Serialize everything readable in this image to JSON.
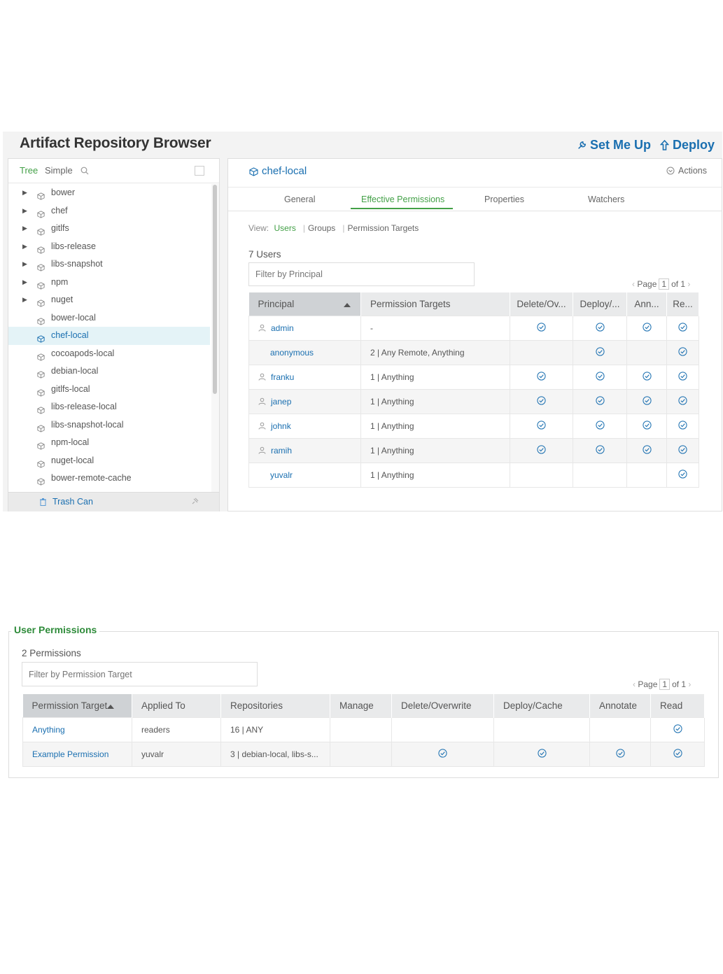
{
  "app": {
    "title": "Artifact Repository Browser",
    "set_me_up": "Set Me Up",
    "deploy": "Deploy"
  },
  "tree": {
    "tab_tree": "Tree",
    "tab_simple": "Simple",
    "items": [
      {
        "label": "bower",
        "expandable": true
      },
      {
        "label": "chef",
        "expandable": true
      },
      {
        "label": "gitlfs",
        "expandable": true
      },
      {
        "label": "libs-release",
        "expandable": true
      },
      {
        "label": "libs-snapshot",
        "expandable": true
      },
      {
        "label": "npm",
        "expandable": true
      },
      {
        "label": "nuget",
        "expandable": true
      },
      {
        "label": "bower-local",
        "expandable": false
      },
      {
        "label": "chef-local",
        "expandable": false,
        "selected": true
      },
      {
        "label": "cocoapods-local",
        "expandable": false
      },
      {
        "label": "debian-local",
        "expandable": false
      },
      {
        "label": "gitlfs-local",
        "expandable": false
      },
      {
        "label": "libs-release-local",
        "expandable": false
      },
      {
        "label": "libs-snapshot-local",
        "expandable": false
      },
      {
        "label": "npm-local",
        "expandable": false
      },
      {
        "label": "nuget-local",
        "expandable": false
      },
      {
        "label": "bower-remote-cache",
        "expandable": false
      }
    ],
    "trash": "Trash Can"
  },
  "detail": {
    "repo": "chef-local",
    "actions": "Actions",
    "tabs": [
      "General",
      "Effective Permissions",
      "Properties",
      "Watchers"
    ],
    "active_tab": "Effective Permissions",
    "view_label": "View:",
    "view_links": [
      "Users",
      "Groups",
      "Permission Targets"
    ],
    "count": "7 Users",
    "filter_placeholder": "Filter by Principal",
    "pager": {
      "page_label": "Page",
      "page": "1",
      "of": "of 1"
    },
    "columns": [
      "Principal",
      "Permission Targets",
      "Delete/Ov...",
      "Deploy/...",
      "Ann...",
      "Re..."
    ],
    "rows": [
      {
        "principal": "admin",
        "icon": true,
        "targets": "-",
        "delete": true,
        "deploy": true,
        "annotate": true,
        "read": true
      },
      {
        "principal": "anonymous",
        "icon": false,
        "targets": "2 | Any Remote, Anything",
        "delete": false,
        "deploy": true,
        "annotate": false,
        "read": true
      },
      {
        "principal": "franku",
        "icon": true,
        "targets": "1 | Anything",
        "delete": true,
        "deploy": true,
        "annotate": true,
        "read": true
      },
      {
        "principal": "janep",
        "icon": true,
        "targets": "1 | Anything",
        "delete": true,
        "deploy": true,
        "annotate": true,
        "read": true
      },
      {
        "principal": "johnk",
        "icon": true,
        "targets": "1 | Anything",
        "delete": true,
        "deploy": true,
        "annotate": true,
        "read": true
      },
      {
        "principal": "ramih",
        "icon": true,
        "targets": "1 | Anything",
        "delete": true,
        "deploy": true,
        "annotate": true,
        "read": true
      },
      {
        "principal": "yuvalr",
        "icon": false,
        "targets": "1 | Anything",
        "delete": false,
        "deploy": false,
        "annotate": false,
        "read": true
      }
    ]
  },
  "user_permissions": {
    "legend": "User Permissions",
    "count": "2 Permissions",
    "filter_placeholder": "Filter by Permission Target",
    "pager": {
      "page_label": "Page",
      "page": "1",
      "of": "of 1"
    },
    "columns": [
      "Permission Target",
      "Applied To",
      "Repositories",
      "Manage",
      "Delete/Overwrite",
      "Deploy/Cache",
      "Annotate",
      "Read"
    ],
    "rows": [
      {
        "target": "Anything",
        "applied_to": "readers",
        "repositories": "16 | ANY",
        "manage": false,
        "delete": false,
        "deploy": false,
        "annotate": false,
        "read": true
      },
      {
        "target": "Example Permission",
        "applied_to": "yuvalr",
        "repositories": "3 | debian-local, libs-s...",
        "manage": false,
        "delete": true,
        "deploy": true,
        "annotate": true,
        "read": true
      }
    ]
  },
  "colors": {
    "link": "#1a6fb0",
    "accent_green": "#43a047",
    "check": "#1a6fb0"
  }
}
